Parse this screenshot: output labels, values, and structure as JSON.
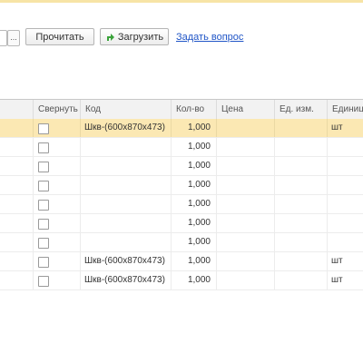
{
  "toolbar": {
    "ellipsis_label": "...",
    "read_label": "Прочитать",
    "load_label": "Загрузить",
    "ask_link": "Задать вопрос"
  },
  "table": {
    "columns": [
      "Свернуть",
      "Код",
      "Кол-во",
      "Цена",
      "Ед. изм.",
      "Единица"
    ],
    "rows": [
      {
        "collapse": false,
        "code": "Шкв-(600х870х473)",
        "qty": "1,000",
        "price": "",
        "unit": "",
        "unit2": "шт",
        "selected": true
      },
      {
        "collapse": false,
        "code": "",
        "qty": "1,000",
        "price": "",
        "unit": "",
        "unit2": ""
      },
      {
        "collapse": false,
        "code": "",
        "qty": "1,000",
        "price": "",
        "unit": "",
        "unit2": ""
      },
      {
        "collapse": false,
        "code": "",
        "qty": "1,000",
        "price": "",
        "unit": "",
        "unit2": ""
      },
      {
        "collapse": false,
        "code": "",
        "qty": "1,000",
        "price": "",
        "unit": "",
        "unit2": ""
      },
      {
        "collapse": false,
        "code": "",
        "qty": "1,000",
        "price": "",
        "unit": "",
        "unit2": ""
      },
      {
        "collapse": false,
        "code": "",
        "qty": "1,000",
        "price": "",
        "unit": "",
        "unit2": ""
      },
      {
        "collapse": false,
        "code": "Шкв-(600х870х473)",
        "qty": "1,000",
        "price": "",
        "unit": "",
        "unit2": "шт"
      },
      {
        "collapse": false,
        "code": "Шкв-(600х870х473)",
        "qty": "1,000",
        "price": "",
        "unit": "",
        "unit2": "шт"
      }
    ]
  },
  "colors": {
    "selected_row": "#fbe8b3",
    "link": "#2156c7",
    "load_icon": "#3aa33a"
  },
  "icons": {
    "load": "green-arrow-icon"
  }
}
